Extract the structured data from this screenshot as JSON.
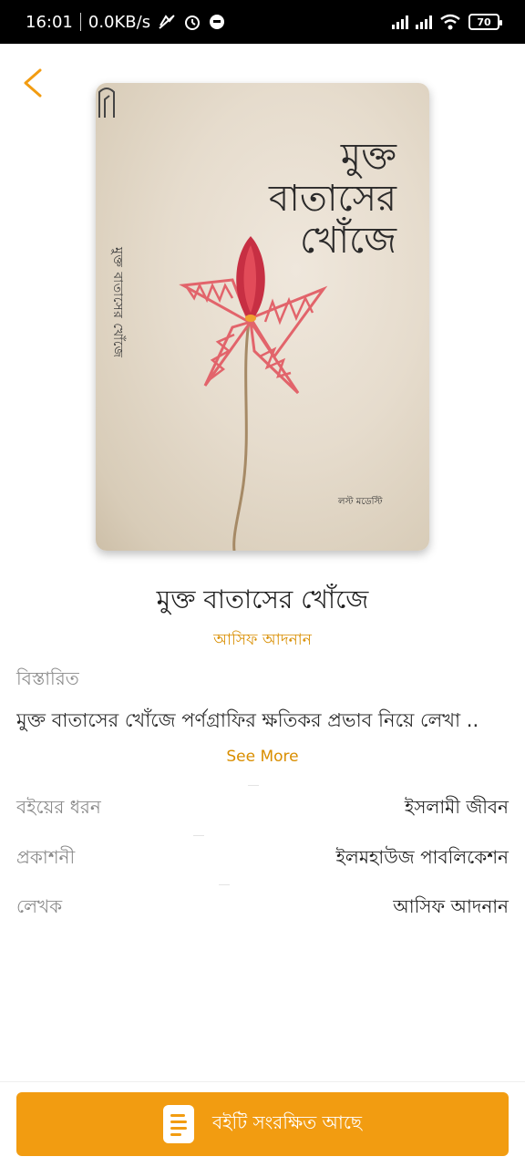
{
  "status_bar": {
    "time": "16:01",
    "network_speed": "0.0KB/s",
    "battery": "70"
  },
  "book": {
    "cover_title_line1": "মুক্ত",
    "cover_title_line2": "বাতাসের",
    "cover_title_line3": "খোঁজে",
    "cover_spine": "মুক্ত বাতাসের খোঁজে",
    "cover_publisher": "লস্ট মডেস্টি",
    "title": "মুক্ত বাতাসের খোঁজে",
    "author": "আসিফ আদনান",
    "details_label": "বিস্তারিত",
    "description": "মুক্ত বাতাসের খোঁজে পর্ণগ্রাফির ক্ষতিকর প্রভাব নিয়ে লেখা ..",
    "see_more": "See More"
  },
  "info": {
    "category_label": "বইয়ের ধরন",
    "category_value": "ইসলামী জীবন",
    "publisher_label": "প্রকাশনী",
    "publisher_value": "ইলমহাউজ পাবলিকেশন",
    "writer_label": "লেখক",
    "writer_value": "আসিফ আদনান"
  },
  "action": {
    "save_label": "বইটি সংরক্ষিত আছে"
  },
  "colors": {
    "accent": "#f29c11",
    "accent_text": "#d98e00",
    "muted": "#8a8a8a"
  },
  "icons": [
    "back-arrow-icon",
    "document-icon",
    "wifi-icon",
    "alarm-icon",
    "signal-icon",
    "battery-icon"
  ]
}
